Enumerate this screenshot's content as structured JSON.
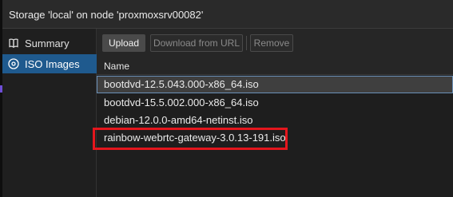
{
  "window": {
    "title": "Storage 'local' on node 'proxmoxsrv00082'"
  },
  "sidebar": {
    "items": [
      {
        "label": "Summary",
        "icon": "book-icon",
        "selected": false
      },
      {
        "label": "ISO Images",
        "icon": "disc-icon",
        "selected": true
      }
    ]
  },
  "toolbar": {
    "upload_label": "Upload",
    "download_label": "Download from URL",
    "remove_label": "Remove"
  },
  "grid": {
    "column_name": "Name",
    "rows": [
      {
        "name": "bootdvd-12.5.043.000-x86_64.iso",
        "selected": true
      },
      {
        "name": "bootdvd-15.5.002.000-x86_64.iso",
        "selected": false
      },
      {
        "name": "debian-12.0.0-amd64-netinst.iso",
        "selected": false
      },
      {
        "name": "rainbow-webrtc-gateway-3.0.13-191.iso",
        "selected": false,
        "highlighted": true
      }
    ]
  },
  "colors": {
    "selection_blue": "#1f5a8e",
    "highlight_red": "#e4161d",
    "accent_purple": "#6d4dd6"
  }
}
